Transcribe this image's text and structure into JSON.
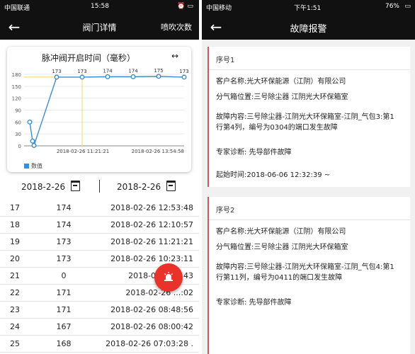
{
  "left": {
    "status": {
      "carrier": "中国联通",
      "time": "15:58"
    },
    "nav": {
      "back": "←",
      "title": "阀门详情",
      "action": "喷吹次数"
    },
    "chart_data": {
      "type": "line",
      "title": "脉冲阀开启时间（毫秒）",
      "expand_icon": "↔",
      "x_ticks": [
        "2018-02-26 11:21:21",
        "2018-02-26 13:54:58"
      ],
      "y_ticks": [
        0,
        30,
        60,
        90,
        120,
        150,
        180
      ],
      "ylim": [
        0,
        180
      ],
      "values": [
        60,
        12,
        1,
        173,
        173,
        174,
        174,
        175,
        173
      ],
      "labels": [
        "",
        "",
        "",
        "173",
        "173",
        "174",
        "174",
        "175",
        "173"
      ],
      "series": [
        {
          "name": "数值",
          "color": "#3b8ed4"
        }
      ],
      "highlight_color": "#f5d76e"
    },
    "date_filter": {
      "start": "2018-2-26",
      "end": "2018-2-26"
    },
    "rows": [
      {
        "idx": "17",
        "val": "174",
        "time": "2018-02-26 12:53:48"
      },
      {
        "idx": "18",
        "val": "174",
        "time": "2018-02-26 12:10:57"
      },
      {
        "idx": "19",
        "val": "173",
        "time": "2018-02-26 11:21:21"
      },
      {
        "idx": "20",
        "val": "173",
        "time": "2018-02-26 10:23:11"
      },
      {
        "idx": "21",
        "val": "0",
        "time": "2018-02-26 ...43"
      },
      {
        "idx": "22",
        "val": "171",
        "time": "2018-02-26 ...:02"
      },
      {
        "idx": "23",
        "val": "171",
        "time": "2018-02-26 08:48:56"
      },
      {
        "idx": "24",
        "val": "167",
        "time": "2018-02-26 08:00:42"
      },
      {
        "idx": "25",
        "val": "168",
        "time": "2018-02-26 07:03:28 ."
      }
    ],
    "fab_icon": "alarm-icon"
  },
  "right": {
    "status": {
      "carrier": "中国移动",
      "time": "下午1:51",
      "battery": "76%"
    },
    "nav": {
      "back": "←",
      "title": "故障报警"
    },
    "cards": [
      {
        "seq": "序号1",
        "customer": "客户名称:光大环保能源（江阴）有限公司",
        "location": "分气箱位置:三号除尘器 江阴光大环保箱室",
        "fault_line1": "故障内容:三号除尘器-江阴光大环保箱室-江阴_气包3:第1",
        "fault_line2": "行第4列，编号为0304的端口发生故障",
        "diagnosis": "专家诊断:  先导部件故障",
        "start": "起始时间:2018-06-06 12:32:39 ~"
      },
      {
        "seq": "序号2",
        "customer": "客户名称:光大环保能源（江阴）有限公司",
        "location": "分气箱位置:三号除尘器 江阴光大环保箱室",
        "fault_line1": "故障内容:三号除尘器-江阴光大环保箱室-江阴_气包4:第1",
        "fault_line2": "行第11列，编号为0411的端口发生故障",
        "diagnosis": "专家诊断:  先导部件故障"
      }
    ]
  }
}
